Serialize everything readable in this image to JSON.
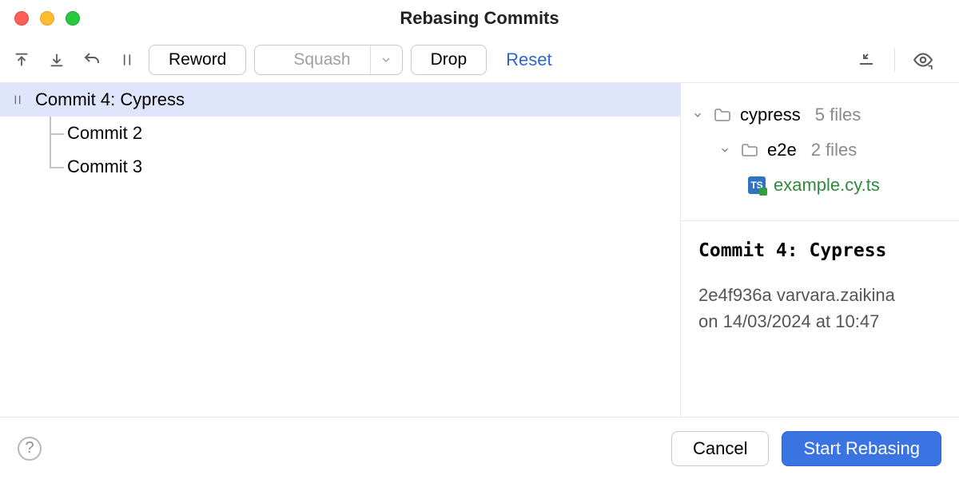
{
  "title": "Rebasing Commits",
  "toolbar": {
    "reword": "Reword",
    "squash": "Squash",
    "drop": "Drop",
    "reset": "Reset"
  },
  "commits": [
    {
      "label": "Commit 4: Cypress",
      "selected": true,
      "has_pause": true
    },
    {
      "label": "Commit 2",
      "selected": false,
      "has_pause": false
    },
    {
      "label": "Commit 3",
      "selected": false,
      "has_pause": false
    }
  ],
  "files": {
    "root": {
      "name": "cypress",
      "count": "5 files"
    },
    "child": {
      "name": "e2e",
      "count": "2 files"
    },
    "leaf": {
      "name": "example.cy.ts",
      "badge": "TS"
    }
  },
  "details": {
    "title": "Commit 4: Cypress",
    "hash_author": "2e4f936a varvara.zaikina",
    "datetime": "on 14/03/2024 at 10:47"
  },
  "footer": {
    "cancel": "Cancel",
    "start": "Start Rebasing"
  }
}
